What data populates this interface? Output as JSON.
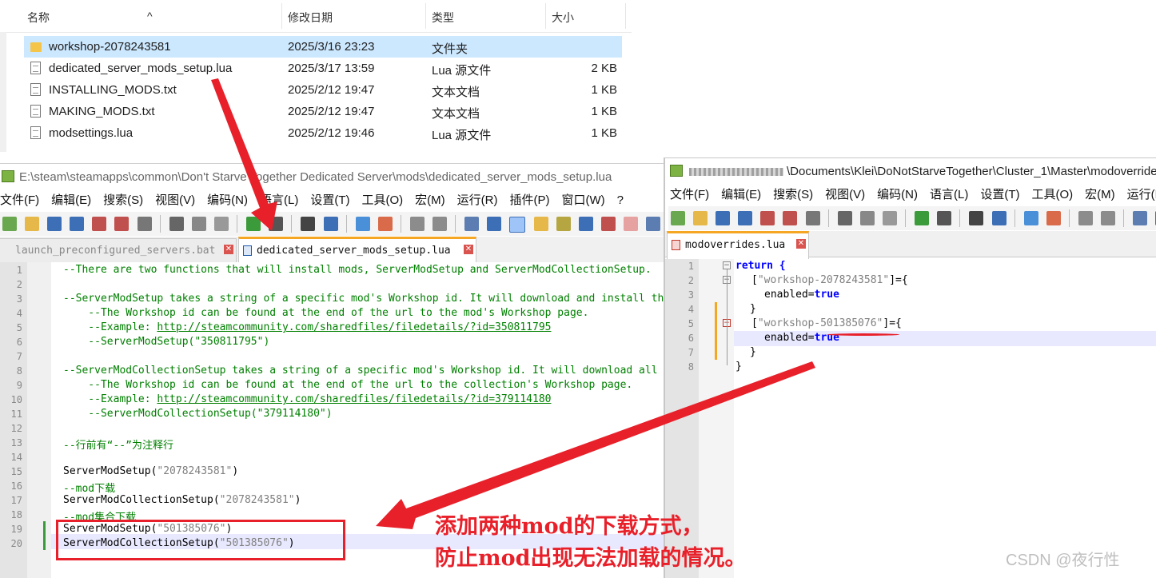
{
  "explorer": {
    "headers": {
      "name": "名称",
      "date": "修改日期",
      "type": "类型",
      "size": "大小"
    },
    "files": [
      {
        "name": "workshop-2078243581",
        "date": "2025/3/16 23:23",
        "type": "文件夹",
        "size": "",
        "icon": "folder-icon",
        "selected": true
      },
      {
        "name": "dedicated_server_mods_setup.lua",
        "date": "2025/3/17 13:59",
        "type": "Lua 源文件",
        "size": "2 KB",
        "icon": "file-icon"
      },
      {
        "name": "INSTALLING_MODS.txt",
        "date": "2025/2/12 19:47",
        "type": "文本文档",
        "size": "1 KB",
        "icon": "file-icon"
      },
      {
        "name": "MAKING_MODS.txt",
        "date": "2025/2/12 19:47",
        "type": "文本文档",
        "size": "1 KB",
        "icon": "file-icon"
      },
      {
        "name": "modsettings.lua",
        "date": "2025/2/12 19:46",
        "type": "Lua 源文件",
        "size": "1 KB",
        "icon": "file-icon"
      }
    ]
  },
  "left_editor": {
    "title": "E:\\steam\\steamapps\\common\\Don't Starve Together Dedicated Server\\mods\\dedicated_server_mods_setup.lua",
    "menu": [
      "文件(F)",
      "编辑(E)",
      "搜索(S)",
      "视图(V)",
      "编码(N)",
      "语言(L)",
      "设置(T)",
      "工具(O)",
      "宏(M)",
      "运行(R)",
      "插件(P)",
      "窗口(W)",
      "?"
    ],
    "tabs": [
      {
        "label": "launch_preconfigured_servers.bat",
        "active": false
      },
      {
        "label": "dedicated_server_mods_setup.lua",
        "active": true
      }
    ],
    "line_numbers": [
      "1",
      "2",
      "3",
      "4",
      "5",
      "6",
      "7",
      "8",
      "9",
      "10",
      "11",
      "12",
      "13",
      "14",
      "15",
      "16",
      "17",
      "18",
      "19",
      "20"
    ],
    "lines": {
      "l1": "--There are two functions that will install mods, ServerModSetup and ServerModCollectionSetup.",
      "l3": "--ServerModSetup takes a string of a specific mod's Workshop id. It will download and install the mod.",
      "l4": "    --The Workshop id can be found at the end of the url to the mod's Workshop page.",
      "l5_prefix": "    --Example: ",
      "l5_url": "http://steamcommunity.com/sharedfiles/filedetails/?id=350811795",
      "l6": "    --ServerModSetup(\"350811795\")",
      "l8": "--ServerModCollectionSetup takes a string of a specific mod's Workshop id. It will download all the mods in the collection.",
      "l9": "    --The Workshop id can be found at the end of the url to the collection's Workshop page.",
      "l10_prefix": "    --Example: ",
      "l10_url": "http://steamcommunity.com/sharedfiles/filedetails/?id=379114180",
      "l11": "    --ServerModCollectionSetup(\"379114180\")",
      "l13": "--行前有“--”为注释行",
      "l15_fn": "ServerModSetup(",
      "l15_str": "\"2078243581\"",
      "l15_end": ")",
      "l16_a": "--mod",
      "l16_b": "下载",
      "l17_fn": "ServerModCollectionSetup(",
      "l17_str": "\"2078243581\"",
      "l17_end": ")",
      "l18_a": "--mod",
      "l18_b": "集合下载",
      "l19_fn": "ServerModSetup(",
      "l19_str": "\"501385076\"",
      "l19_end": ")",
      "l20_fn": "ServerModCollectionSetup(",
      "l20_str": "\"501385076\"",
      "l20_end": ")"
    }
  },
  "right_editor": {
    "title": "\\Documents\\Klei\\DoNotStarveTogether\\Cluster_1\\Master\\modoverrides.lua",
    "menu": [
      "文件(F)",
      "编辑(E)",
      "搜索(S)",
      "视图(V)",
      "编码(N)",
      "语言(L)",
      "设置(T)",
      "工具(O)",
      "宏(M)",
      "运行(R)"
    ],
    "tabs": [
      {
        "label": "modoverrides.lua",
        "active": true
      }
    ],
    "line_numbers": [
      "1",
      "2",
      "3",
      "4",
      "5",
      "6",
      "7",
      "8"
    ],
    "lines": {
      "l1": "return {",
      "l2_open": "[",
      "l2_str": "\"workshop-2078243581\"",
      "l2_close": "]={",
      "l3_key": "enabled=",
      "l3_val": "true",
      "l4": "}",
      "l5_open": "[",
      "l5_str": "\"workshop-501385076\"",
      "l5_close": "]={",
      "l6_key": "enabled=",
      "l6_val": "true",
      "l7": "}",
      "l8": "}"
    }
  },
  "annotation": {
    "line1": "添加两种mod的下载方式，",
    "line2": "防止mod出现无法加载的情况。",
    "color": "#e8202a"
  },
  "watermark": "CSDN @夜行性"
}
